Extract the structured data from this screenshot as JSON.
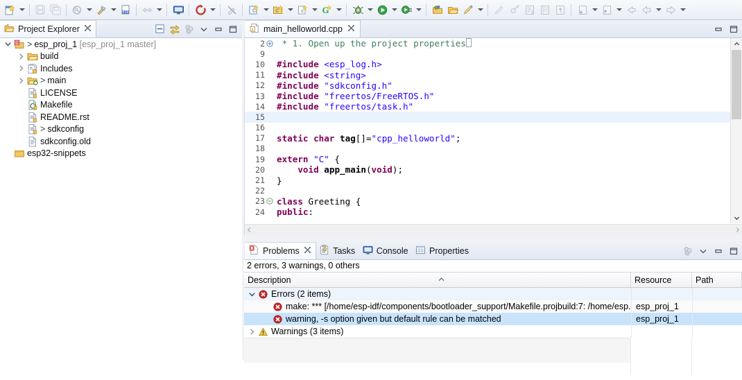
{
  "toolbar": {
    "groups": [
      {
        "items": [
          {
            "icon": "new-wizard-icon",
            "arrow": true
          }
        ]
      },
      {
        "items": [
          {
            "icon": "save-icon",
            "arrow": false
          },
          {
            "icon": "save-all-icon",
            "arrow": false
          }
        ]
      },
      {
        "items": [
          {
            "icon": "build-all-icon",
            "arrow": true
          },
          {
            "icon": "build-hammer-icon",
            "arrow": true
          },
          {
            "icon": "binary-010-icon",
            "arrow": false
          }
        ]
      },
      {
        "items": [
          {
            "icon": "resize-arrows-icon",
            "arrow": true
          },
          {
            "icon": "console-icon",
            "arrow": false
          },
          {
            "icon": "refresh-red-icon",
            "arrow": true
          },
          {
            "icon": "no-build-icon",
            "arrow": false
          }
        ]
      },
      {
        "items": [
          {
            "icon": "new-c-file-icon",
            "arrow": true
          },
          {
            "icon": "new-c-folder-icon",
            "arrow": true
          },
          {
            "icon": "new-c-source-icon",
            "arrow": true
          },
          {
            "icon": "new-class-g-icon",
            "arrow": true
          }
        ]
      },
      {
        "items": [
          {
            "icon": "debug-bug-icon",
            "arrow": true
          },
          {
            "icon": "run-icon",
            "arrow": true
          },
          {
            "icon": "external-tools-icon",
            "arrow": true
          }
        ]
      },
      {
        "items": [
          {
            "icon": "open-folder-green-icon",
            "arrow": false
          },
          {
            "icon": "open-folder-icon",
            "arrow": false
          },
          {
            "icon": "pencil-yellow-icon",
            "arrow": true
          }
        ]
      },
      {
        "items": [
          {
            "icon": "pencil-gray-icon",
            "arrow": false
          },
          {
            "icon": "search-pin-icon",
            "arrow": false
          },
          {
            "icon": "toggle-block-icon",
            "arrow": false
          },
          {
            "icon": "book-icon",
            "arrow": false
          },
          {
            "icon": "pilcrow-icon",
            "arrow": false
          }
        ]
      },
      {
        "items": [
          {
            "icon": "next-annotation-icon",
            "arrow": true
          },
          {
            "icon": "prev-annotation-icon",
            "arrow": true
          },
          {
            "icon": "back-history-icon",
            "arrow": false
          },
          {
            "icon": "back-arrow-icon",
            "arrow": true
          },
          {
            "icon": "forward-arrow-icon",
            "arrow": true
          }
        ]
      }
    ]
  },
  "project_explorer": {
    "tab_label": "Project Explorer",
    "tab_icon": "project-explorer-icon",
    "close_icon": "close-tab-icon",
    "tools": [
      {
        "name": "collapse-all-icon"
      },
      {
        "name": "link-with-editor-icon"
      },
      {
        "name": "view-menu-balls-icon"
      },
      {
        "name": "view-menu-chevron-icon"
      },
      {
        "name": "minimize-view-icon"
      },
      {
        "name": "maximize-view-icon"
      }
    ],
    "tree": [
      {
        "indent": 0,
        "twisty": "expanded",
        "icon": "project-c-icon",
        "gt": true,
        "label": "esp_proj_1",
        "suffix": "[esp_proj_1 master]"
      },
      {
        "indent": 1,
        "twisty": "collapsed",
        "icon": "folder-icon",
        "gt": false,
        "label": "build",
        "suffix": ""
      },
      {
        "indent": 1,
        "twisty": "collapsed",
        "icon": "includes-icon",
        "gt": false,
        "label": "Includes",
        "suffix": ""
      },
      {
        "indent": 1,
        "twisty": "collapsed",
        "icon": "source-folder-icon",
        "gt": true,
        "label": "main",
        "suffix": ""
      },
      {
        "indent": 1,
        "twisty": "none",
        "icon": "file-doc-icon",
        "gt": false,
        "label": "LICENSE",
        "suffix": ""
      },
      {
        "indent": 1,
        "twisty": "none",
        "icon": "makefile-icon",
        "gt": false,
        "label": "Makefile",
        "suffix": ""
      },
      {
        "indent": 1,
        "twisty": "none",
        "icon": "file-doc-icon",
        "gt": false,
        "label": "README.rst",
        "suffix": ""
      },
      {
        "indent": 1,
        "twisty": "none",
        "icon": "file-doc-icon",
        "gt": true,
        "label": "sdkconfig",
        "suffix": ""
      },
      {
        "indent": 1,
        "twisty": "none",
        "icon": "file-plain-icon",
        "gt": false,
        "label": "sdkconfig.old",
        "suffix": ""
      },
      {
        "indent": 0,
        "twisty": "none",
        "icon": "closed-project-icon",
        "gt": false,
        "label": "esp32-snippets",
        "suffix": ""
      }
    ]
  },
  "editor": {
    "tab_label": "main_helloworld.cpp",
    "tab_icon": "cpp-file-icon",
    "close_icon": "close-tab-icon",
    "tools": [
      {
        "name": "minimize-editor-icon"
      },
      {
        "name": "maximize-editor-icon"
      }
    ],
    "lines": [
      {
        "num": "2",
        "fold": "plus",
        "highlight": false,
        "tokens": [
          {
            "t": "cmt",
            "v": " * 1. Open up the project properties"
          },
          {
            "t": "caret",
            "v": ""
          }
        ]
      },
      {
        "num": "9",
        "fold": "",
        "highlight": false,
        "tokens": []
      },
      {
        "num": "10",
        "fold": "",
        "highlight": false,
        "tokens": [
          {
            "t": "ppc",
            "v": "#include"
          },
          {
            "t": "plain",
            "v": " "
          },
          {
            "t": "str",
            "v": "<esp_log.h>"
          }
        ]
      },
      {
        "num": "11",
        "fold": "",
        "highlight": false,
        "tokens": [
          {
            "t": "ppc",
            "v": "#include"
          },
          {
            "t": "plain",
            "v": " "
          },
          {
            "t": "str",
            "v": "<string>"
          }
        ]
      },
      {
        "num": "12",
        "fold": "",
        "highlight": false,
        "tokens": [
          {
            "t": "ppc",
            "v": "#include"
          },
          {
            "t": "plain",
            "v": " "
          },
          {
            "t": "str",
            "v": "\"sdkconfig.h\""
          }
        ]
      },
      {
        "num": "13",
        "fold": "",
        "highlight": false,
        "tokens": [
          {
            "t": "ppc",
            "v": "#include"
          },
          {
            "t": "plain",
            "v": " "
          },
          {
            "t": "str",
            "v": "\"freertos/FreeRTOS.h\""
          }
        ]
      },
      {
        "num": "14",
        "fold": "",
        "highlight": false,
        "tokens": [
          {
            "t": "ppc",
            "v": "#include"
          },
          {
            "t": "plain",
            "v": " "
          },
          {
            "t": "str",
            "v": "\"freertos/task.h\""
          }
        ]
      },
      {
        "num": "15",
        "fold": "",
        "highlight": true,
        "tokens": []
      },
      {
        "num": "16",
        "fold": "",
        "highlight": false,
        "tokens": []
      },
      {
        "num": "17",
        "fold": "",
        "highlight": false,
        "tokens": [
          {
            "t": "kw",
            "v": "static"
          },
          {
            "t": "plain",
            "v": " "
          },
          {
            "t": "kw",
            "v": "char"
          },
          {
            "t": "plain",
            "v": " "
          },
          {
            "t": "bold",
            "v": "tag"
          },
          {
            "t": "plain",
            "v": "[]="
          },
          {
            "t": "str",
            "v": "\"cpp_helloworld\""
          },
          {
            "t": "plain",
            "v": ";"
          }
        ]
      },
      {
        "num": "18",
        "fold": "",
        "highlight": false,
        "tokens": []
      },
      {
        "num": "19",
        "fold": "",
        "highlight": false,
        "tokens": [
          {
            "t": "kw",
            "v": "extern"
          },
          {
            "t": "plain",
            "v": " "
          },
          {
            "t": "str",
            "v": "\"C\""
          },
          {
            "t": "plain",
            "v": " {"
          }
        ]
      },
      {
        "num": "20",
        "fold": "",
        "highlight": false,
        "tokens": [
          {
            "t": "plain",
            "v": "    "
          },
          {
            "t": "kw",
            "v": "void"
          },
          {
            "t": "plain",
            "v": " "
          },
          {
            "t": "bold",
            "v": "app_main"
          },
          {
            "t": "plain",
            "v": "("
          },
          {
            "t": "kw",
            "v": "void"
          },
          {
            "t": "plain",
            "v": ");"
          }
        ]
      },
      {
        "num": "21",
        "fold": "",
        "highlight": false,
        "tokens": [
          {
            "t": "plain",
            "v": "}"
          }
        ]
      },
      {
        "num": "22",
        "fold": "",
        "highlight": false,
        "tokens": []
      },
      {
        "num": "23",
        "fold": "minus",
        "highlight": false,
        "tokens": [
          {
            "t": "kw",
            "v": "class"
          },
          {
            "t": "plain",
            "v": " Greeting {"
          }
        ]
      },
      {
        "num": "24",
        "fold": "",
        "highlight": false,
        "tokens": [
          {
            "t": "kw",
            "v": "public"
          },
          {
            "t": "plain",
            "v": ":"
          }
        ]
      }
    ],
    "scroll": {
      "vertical_icon_up": "scroll-up-icon",
      "vertical_icon_down": "scroll-down-icon",
      "left_icon": "scroll-left-icon",
      "right_icon": "scroll-right-icon"
    }
  },
  "problems_view": {
    "tabs": [
      {
        "label": "Problems",
        "icon": "problems-icon",
        "active": true,
        "close_icon": "close-tab-icon"
      },
      {
        "label": "Tasks",
        "icon": "tasks-icon",
        "active": false
      },
      {
        "label": "Console",
        "icon": "console-view-icon",
        "active": false
      },
      {
        "label": "Properties",
        "icon": "properties-icon",
        "active": false
      }
    ],
    "tools": [
      {
        "name": "view-menu-balls-icon"
      },
      {
        "name": "view-menu-chevron-icon"
      },
      {
        "name": "minimize-view-icon"
      },
      {
        "name": "maximize-view-icon"
      }
    ],
    "summary": "2 errors, 3 warnings, 0 others",
    "columns": [
      {
        "label": "Description",
        "sort": "asc"
      },
      {
        "label": "Resource",
        "sort": ""
      },
      {
        "label": "Path",
        "sort": ""
      }
    ],
    "rows": [
      {
        "level": 0,
        "twisty": "expanded",
        "icon": "error-icon",
        "description": "Errors (2 items)",
        "resource": "",
        "path": "",
        "selected": false,
        "shade": "light"
      },
      {
        "level": 1,
        "twisty": "none",
        "icon": "error-icon",
        "description": "make: *** [/home/esp-idf/components/bootloader_support/Makefile.projbuild:7: /home/esp.",
        "resource": "esp_proj_1",
        "path": "",
        "selected": false,
        "shade": "none"
      },
      {
        "level": 1,
        "twisty": "none",
        "icon": "error-icon",
        "description": "warning, -s option given but default rule can be matched",
        "resource": "esp_proj_1",
        "path": "",
        "selected": true,
        "shade": "none"
      },
      {
        "level": 0,
        "twisty": "collapsed",
        "icon": "warning-icon",
        "description": "Warnings (3 items)",
        "resource": "",
        "path": "",
        "selected": false,
        "shade": "none"
      }
    ]
  },
  "colors": {
    "selection_blue": "#c9e3fb",
    "current_line": "#eaf2fb",
    "keyword": "#7f0055",
    "string": "#2a00ff",
    "comment": "#3f7f5f",
    "error_red": "#cc0000",
    "warning_yellow": "#f0c419",
    "tab_gradient_top": "#eef2f8"
  }
}
